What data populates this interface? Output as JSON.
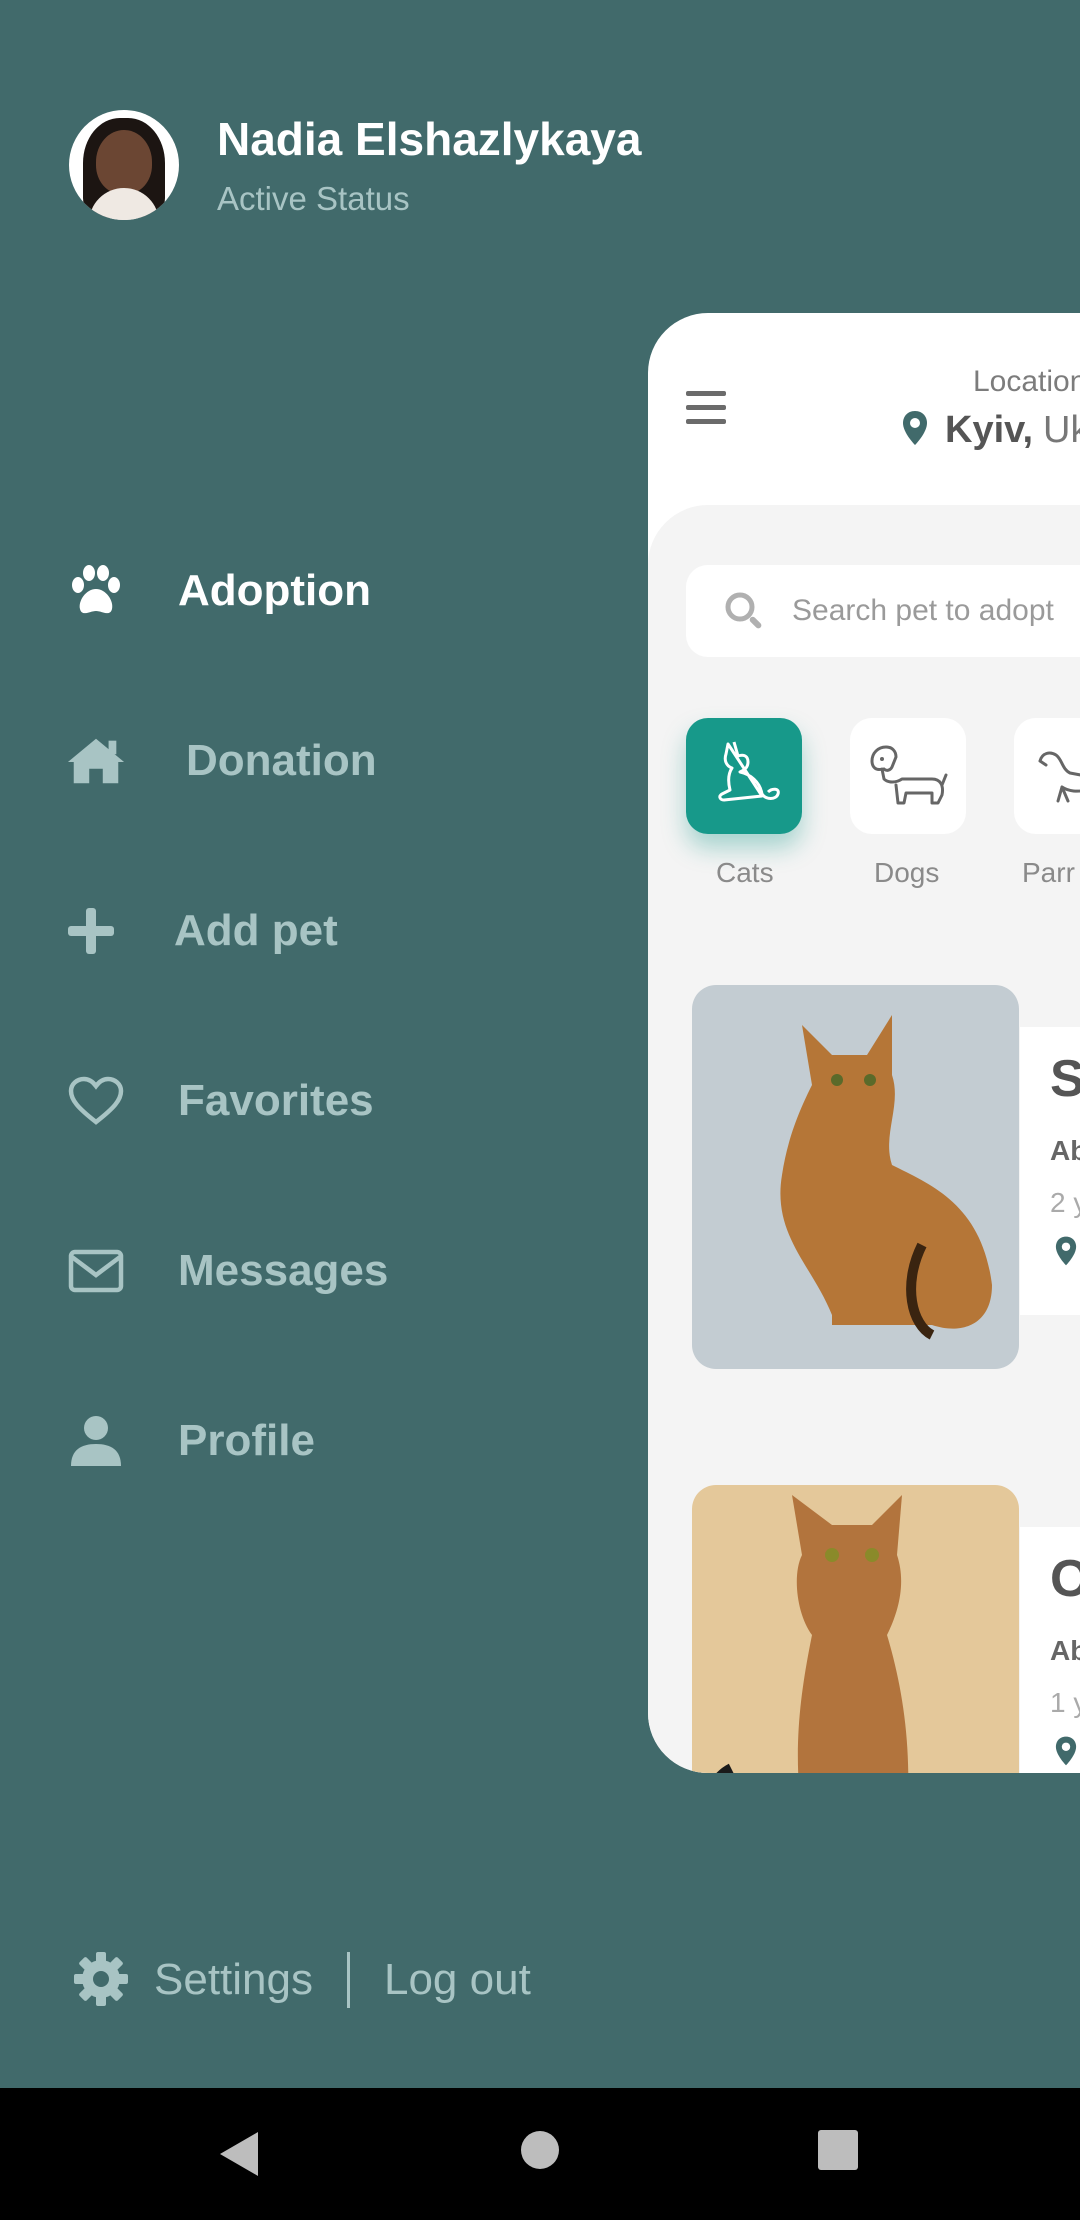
{
  "user": {
    "name": "Nadia Elshazlykaya",
    "status": "Active Status"
  },
  "menu": [
    {
      "label": "Adoption",
      "icon": "paw-icon",
      "active": true
    },
    {
      "label": "Donation",
      "icon": "home-icon",
      "active": false
    },
    {
      "label": "Add pet",
      "icon": "plus-icon",
      "active": false
    },
    {
      "label": "Favorites",
      "icon": "heart-icon",
      "active": false
    },
    {
      "label": "Messages",
      "icon": "mail-icon",
      "active": false
    },
    {
      "label": "Profile",
      "icon": "person-icon",
      "active": false
    }
  ],
  "footer": {
    "settings": "Settings",
    "logout": "Log out"
  },
  "preview": {
    "location_label": "Location",
    "city": "Kyiv,",
    "country": "Uk",
    "search_placeholder": "Search pet to adopt",
    "categories": [
      {
        "label": "Cats",
        "active": true
      },
      {
        "label": "Dogs",
        "active": false
      },
      {
        "label": "Parr",
        "active": false
      }
    ],
    "pets": [
      {
        "name": "S",
        "breed": "Ab",
        "age": "2 y"
      },
      {
        "name": "O",
        "breed": "Ab",
        "age": "1 y"
      }
    ]
  },
  "colors": {
    "background": "#416a6b",
    "accent": "#17998a",
    "muted_text": "#a8c4c4"
  }
}
